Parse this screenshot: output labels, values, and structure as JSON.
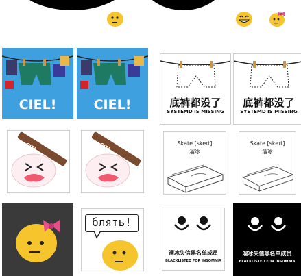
{
  "colors": {
    "blue_bg": "#3ea0df",
    "blob_yellow": "#f6c42c",
    "bow_pink": "#e84e89",
    "dark_bg": "#3a3a3a"
  },
  "top_row": {
    "icons": [
      "blob-neutral-icon",
      "blob-grin-icon",
      "blob-bow-icon"
    ]
  },
  "tiles": {
    "ciel_1": {
      "caption": "CIEL!"
    },
    "ciel_2": {
      "caption": "CIEL!"
    },
    "systemd_1": {
      "cn": "底裤都没了",
      "en": "SYSTEMD IS MISSING"
    },
    "systemd_2": {
      "cn": "底裤都没了",
      "en": "SYSTEMD IS MISSING"
    },
    "sign_1": {
      "text": "CIEL"
    },
    "sign_2": {
      "text": "CIEL"
    },
    "skate_1": {
      "en": "Skate [skeɪt]",
      "cn": "溜冰"
    },
    "skate_2": {
      "en": "Skate [skeɪt]",
      "cn": "溜冰"
    },
    "blyat": {
      "bubble": "блять!"
    },
    "insomnia_1": {
      "cn": "溜冰失信黑名单成员",
      "en": "BLACKLISTED FOR INSOMNIA"
    },
    "insomnia_2": {
      "cn": "溜冰失信黑名单成员",
      "en": "BLACKLISTED FOR INSOMNIA"
    }
  }
}
